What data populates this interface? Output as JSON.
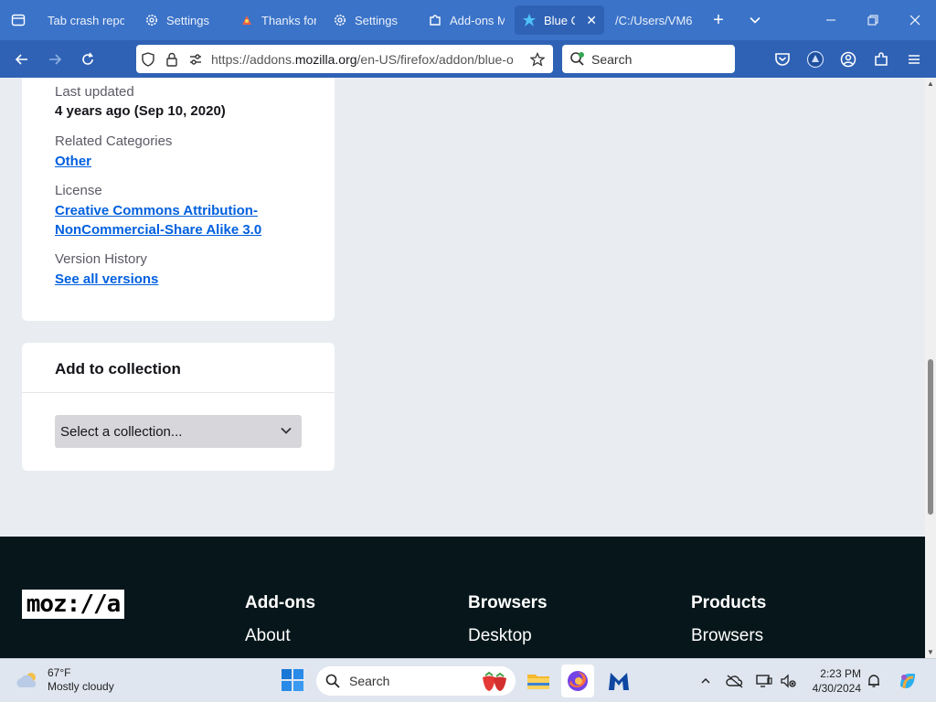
{
  "browser": {
    "tabs": [
      {
        "label": "Tab crash repo",
        "icon": "crash-report-icon",
        "active": false
      },
      {
        "label": "Settings",
        "icon": "gear-icon",
        "active": false
      },
      {
        "label": "Thanks for",
        "icon": "thanks-icon",
        "active": false
      },
      {
        "label": "Settings",
        "icon": "gear-icon",
        "active": false
      },
      {
        "label": "Add-ons M",
        "icon": "puzzle-icon",
        "active": false
      },
      {
        "label": "Blue Ov",
        "icon": "blue-addon-icon",
        "active": true
      },
      {
        "label": "/C:/Users/VM6",
        "icon": "file-icon",
        "active": false
      }
    ],
    "url": {
      "prefix": "https://addons.",
      "domain": "mozilla.org",
      "path": "/en-US/firefox/addon/blue-o"
    },
    "search_placeholder": "Search"
  },
  "sidebar_meta": {
    "last_updated_label": "Last updated",
    "last_updated_value": "4 years ago (Sep 10, 2020)",
    "categories_label": "Related Categories",
    "categories_link": "Other",
    "license_label": "License",
    "license_link": "Creative Commons Attribution-NonCommercial-Share Alike 3.0",
    "version_label": "Version History",
    "version_link": "See all versions"
  },
  "collection": {
    "title": "Add to collection",
    "select_value": "Select a collection..."
  },
  "footer": {
    "logo": "moz://a",
    "columns": [
      {
        "heading": "Add-ons",
        "first_link": "About"
      },
      {
        "heading": "Browsers",
        "first_link": "Desktop"
      },
      {
        "heading": "Products",
        "first_link": "Browsers"
      }
    ]
  },
  "taskbar": {
    "weather_temp": "67°F",
    "weather_desc": "Mostly cloudy",
    "search_label": "Search",
    "time": "2:23 PM",
    "date": "4/30/2024"
  },
  "colors": {
    "tab_strip": "#3b73c8",
    "nav_bar": "#2f62b5",
    "link": "#0060df",
    "footer_bg": "#06161a"
  }
}
